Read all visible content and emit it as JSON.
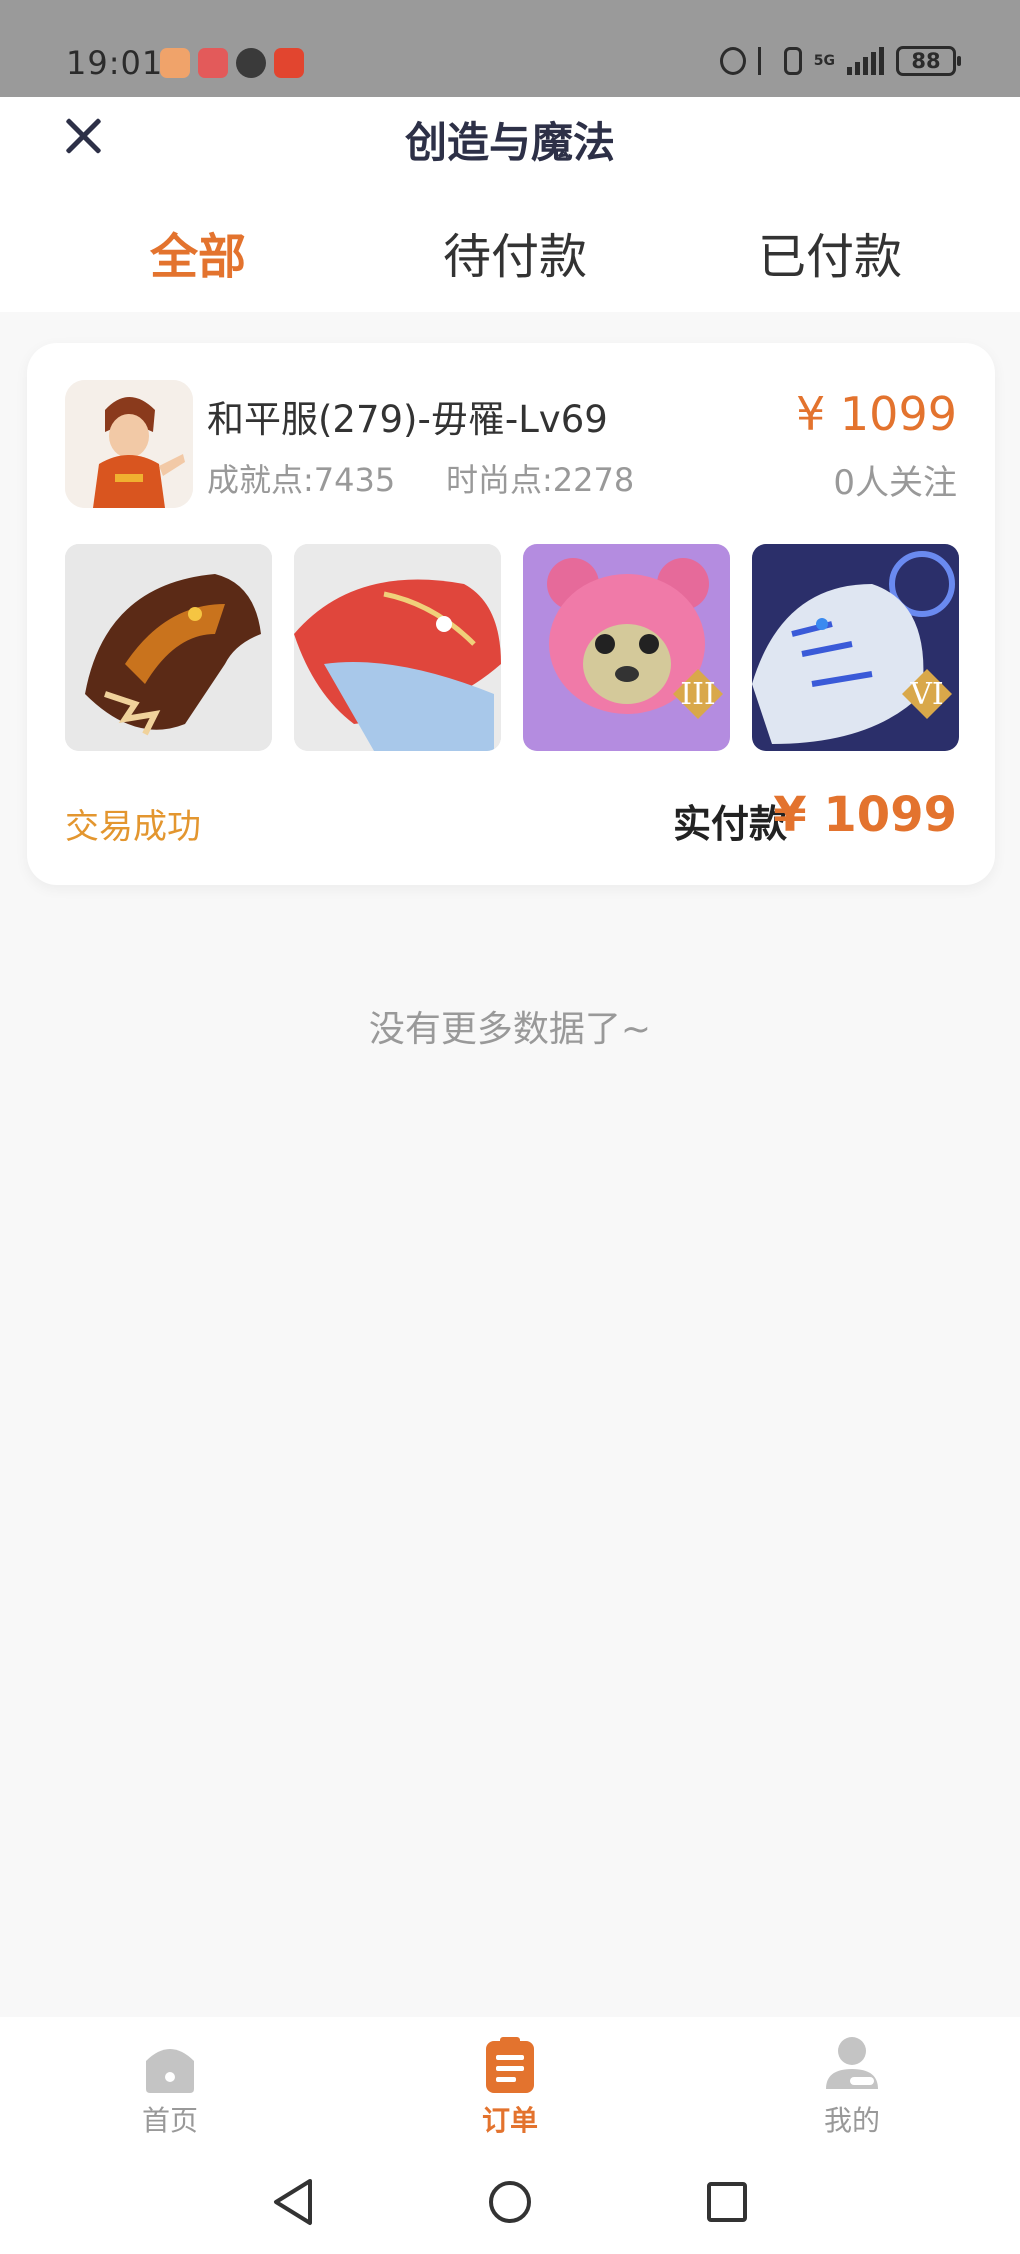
{
  "status_bar": {
    "time": "19:01",
    "network": "5G",
    "battery": "88"
  },
  "header": {
    "title": "创造与魔法",
    "tabs": [
      {
        "label": "全部",
        "active": true
      },
      {
        "label": "待付款",
        "active": false
      },
      {
        "label": "已付款",
        "active": false
      }
    ]
  },
  "order": {
    "server_name": "和平服(279)-毋罹-Lv69",
    "achievement": "成就点:7435",
    "fashion": "时尚点:2278",
    "price": "¥ 1099",
    "followers": "0人关注",
    "status": "交易成功",
    "paid_label": "实付款",
    "paid_amount": "¥ 1099",
    "thumbnails": [
      "dragon-mount",
      "shark-mount",
      "pink-bear-pet",
      "white-tiger-mount"
    ],
    "badges": [
      "III",
      "VI"
    ]
  },
  "empty_text": "没有更多数据了~",
  "bottom_nav": [
    {
      "label": "首页",
      "icon": "home-icon"
    },
    {
      "label": "订单",
      "icon": "clipboard-icon"
    },
    {
      "label": "我的",
      "icon": "user-icon"
    }
  ],
  "colors": {
    "accent": "#e3732e",
    "success": "#e3962f",
    "title": "#2d3047"
  }
}
